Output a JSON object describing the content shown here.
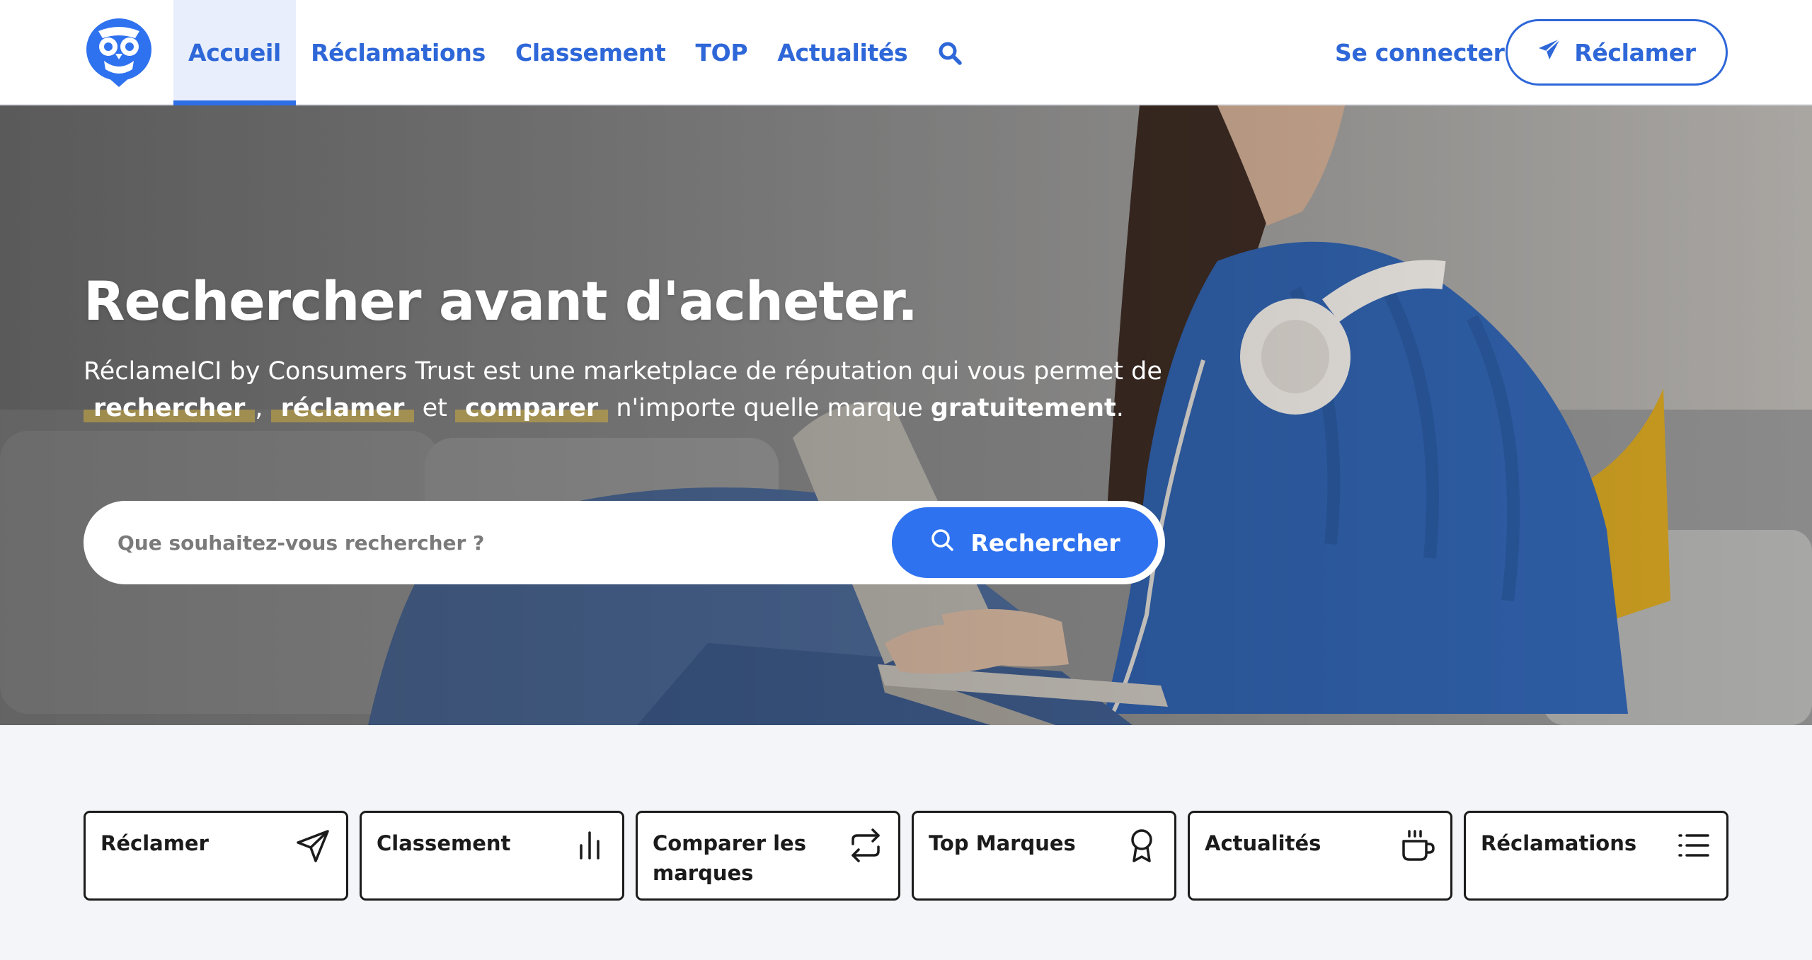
{
  "header": {
    "logo_icon": "owl-logo-icon",
    "nav": [
      {
        "label": "Accueil",
        "active": true
      },
      {
        "label": "Réclamations",
        "active": false
      },
      {
        "label": "Classement",
        "active": false
      },
      {
        "label": "TOP",
        "active": false
      },
      {
        "label": "Actualités",
        "active": false
      }
    ],
    "search_icon": "search-icon",
    "login_label": "Se connecter",
    "reclamer_label": "Réclamer",
    "reclamer_icon": "paper-plane-icon"
  },
  "hero": {
    "title": "Rechercher avant d'acheter.",
    "desc_line1": "RéclameICI by Consumers Trust est une marketplace de réputation qui vous permet de",
    "kw1": "rechercher",
    "sep1": ",",
    "kw2": "réclamer",
    "sep2": "et",
    "kw3": "comparer",
    "desc_tail": "n'importe quelle marque",
    "desc_bold": "gratuitement",
    "desc_end": ".",
    "search_placeholder": "Que souhaitez-vous rechercher ?",
    "search_button": "Rechercher"
  },
  "cards": [
    {
      "label": "Réclamer",
      "icon": "paper-plane-icon"
    },
    {
      "label": "Classement",
      "icon": "bar-chart-icon"
    },
    {
      "label": "Comparer les marques",
      "icon": "swap-arrows-icon"
    },
    {
      "label": "Top Marques",
      "icon": "award-ribbon-icon"
    },
    {
      "label": "Actualités",
      "icon": "coffee-cup-icon"
    },
    {
      "label": "Réclamations",
      "icon": "list-icon"
    }
  ],
  "colors": {
    "primary": "#2e67d8",
    "button_blue": "#2f72ef",
    "highlight": "#ceac3c",
    "page_bg": "#f4f5f9"
  }
}
